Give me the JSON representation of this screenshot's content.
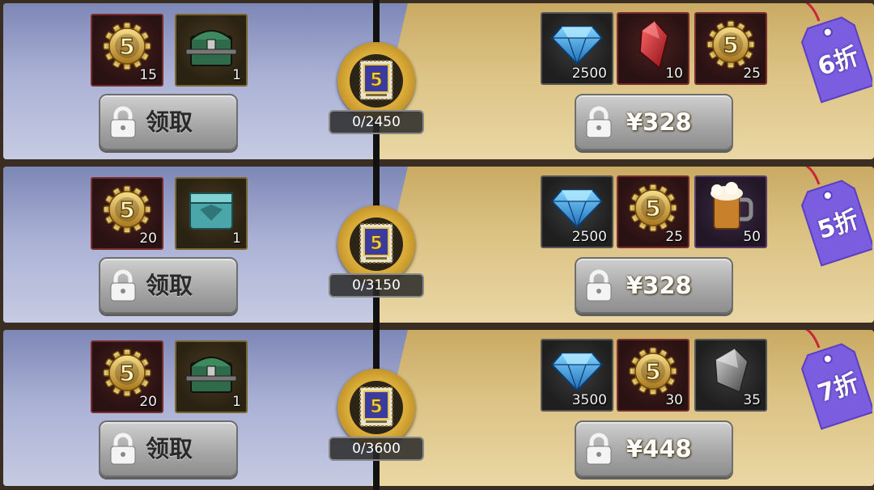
{
  "tiers": [
    {
      "free_items": [
        {
          "name": "token-5-icon",
          "count": "15",
          "style": "red"
        },
        {
          "name": "chest-green-icon",
          "count": "1",
          "style": "gold"
        }
      ],
      "claim_label": "领取",
      "progress": "0/2450",
      "paid_items": [
        {
          "name": "diamond-icon",
          "count": "2500",
          "style": "dark"
        },
        {
          "name": "red-crystal-icon",
          "count": "10",
          "style": "red"
        },
        {
          "name": "token-5-icon",
          "count": "25",
          "style": "red"
        }
      ],
      "price": "¥328",
      "discount": "6折"
    },
    {
      "free_items": [
        {
          "name": "token-5-icon",
          "count": "20",
          "style": "red"
        },
        {
          "name": "chest-teal-icon",
          "count": "1",
          "style": "gold"
        }
      ],
      "claim_label": "领取",
      "progress": "0/3150",
      "paid_items": [
        {
          "name": "diamond-icon",
          "count": "2500",
          "style": "dark"
        },
        {
          "name": "token-5-icon",
          "count": "25",
          "style": "red"
        },
        {
          "name": "beer-mug-icon",
          "count": "50",
          "style": "purple"
        }
      ],
      "price": "¥328",
      "discount": "5折"
    },
    {
      "free_items": [
        {
          "name": "token-5-icon",
          "count": "20",
          "style": "red"
        },
        {
          "name": "chest-green-icon",
          "count": "1",
          "style": "gold"
        }
      ],
      "claim_label": "领取",
      "progress": "0/3600",
      "paid_items": [
        {
          "name": "diamond-icon",
          "count": "3500",
          "style": "dark"
        },
        {
          "name": "token-5-icon",
          "count": "30",
          "style": "red"
        },
        {
          "name": "silver-crystal-icon",
          "count": "35",
          "style": "dark"
        }
      ],
      "price": "¥448",
      "discount": "7折"
    }
  ],
  "colors": {
    "free_bg": "#a9b0d4",
    "paid_bg": "#dcc385",
    "tag_purple": "#7b5ee0",
    "tag_string": "#c8273a"
  }
}
